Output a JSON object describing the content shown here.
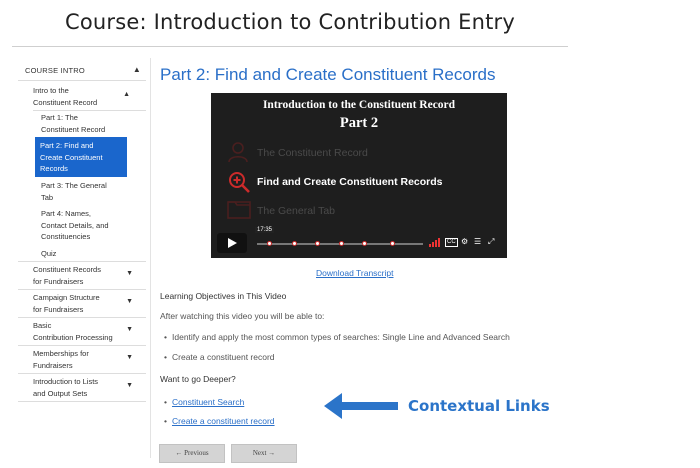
{
  "page": {
    "title": "Course: Introduction to Contribution Entry"
  },
  "sidebar": {
    "header": "COURSE INTRO",
    "items": [
      {
        "label_1": "Intro to the",
        "label_2": "Constituent Record"
      },
      {
        "label_1": "Part 1: The",
        "label_2": "Constituent Record"
      },
      {
        "label_1": "Part 2: Find and",
        "label_2": "Create Constituent",
        "label_3": "Records"
      },
      {
        "label_1": "Part 3: The General",
        "label_2": "Tab"
      },
      {
        "label_1": "Part 4: Names,",
        "label_2": "Contact Details, and",
        "label_3": "Constituencies"
      },
      {
        "label_1": "Quiz"
      },
      {
        "label_1": "Constituent Records",
        "label_2": "for Fundraisers"
      },
      {
        "label_1": "Campaign Structure",
        "label_2": "for Fundraisers"
      },
      {
        "label_1": "Basic",
        "label_2": "Contribution Processing"
      },
      {
        "label_1": "Memberships for",
        "label_2": "Fundraisers"
      },
      {
        "label_1": "Introduction to Lists",
        "label_2": "and Output Sets"
      }
    ]
  },
  "main": {
    "heading": "Part 2: Find and Create Constituent Records",
    "video": {
      "title_line1": "Introduction to the Constituent Record",
      "title_line2": "Part 2",
      "rows": [
        "The Constituent Record",
        "Find and Create Constituent Records",
        "The General Tab"
      ],
      "time": "17:35"
    },
    "download": "Download Transcript",
    "objectives_heading": "Learning Objectives in This Video",
    "objectives_intro": "After watching this video you will be able to:",
    "objectives": [
      "Identify and apply the most common types of searches: Single Line and Advanced Search",
      "Create a constituent record"
    ],
    "deeper_heading": "Want to go Deeper?",
    "links": [
      "Constituent Search",
      "Create a constituent record"
    ],
    "annotation": "Contextual Links",
    "prev": "← Previous",
    "next": "Next →"
  },
  "colors": {
    "accent": "#1a66cc",
    "link": "#2a6fc8",
    "annotation": "#2b74c9",
    "video_bg": "#1e1e1e",
    "highlight_red": "#cc2b2b"
  }
}
